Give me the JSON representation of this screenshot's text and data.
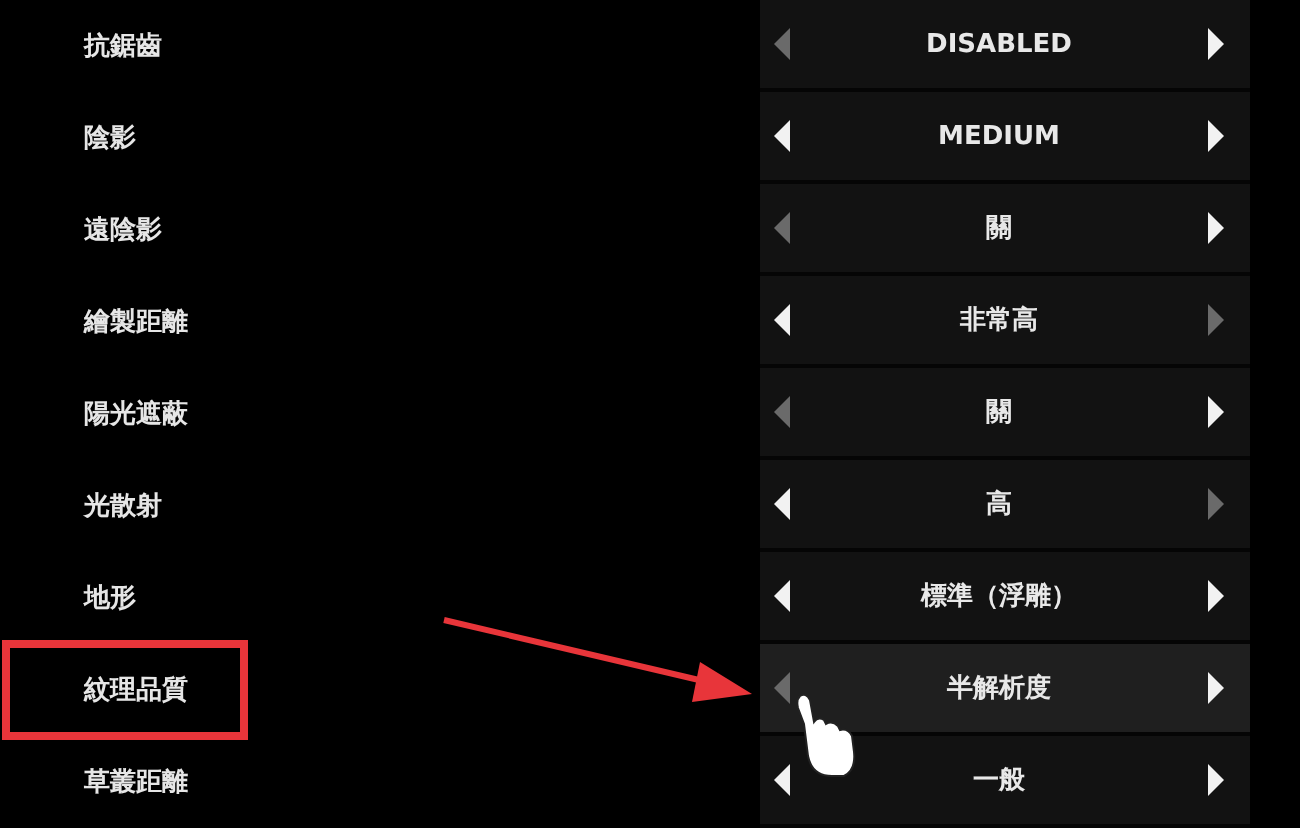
{
  "settings": [
    {
      "label": "抗鋸齒",
      "value": "DISABLED",
      "left_enabled": false,
      "right_enabled": true,
      "selected": false,
      "outlined": false
    },
    {
      "label": "陰影",
      "value": "MEDIUM",
      "left_enabled": true,
      "right_enabled": true,
      "selected": false,
      "outlined": false
    },
    {
      "label": "遠陰影",
      "value": "關",
      "left_enabled": false,
      "right_enabled": true,
      "selected": false,
      "outlined": false
    },
    {
      "label": "繪製距離",
      "value": "非常高",
      "left_enabled": true,
      "right_enabled": false,
      "selected": false,
      "outlined": false
    },
    {
      "label": "陽光遮蔽",
      "value": "關",
      "left_enabled": false,
      "right_enabled": true,
      "selected": false,
      "outlined": false
    },
    {
      "label": "光散射",
      "value": "高",
      "left_enabled": true,
      "right_enabled": false,
      "selected": false,
      "outlined": false
    },
    {
      "label": "地形",
      "value": "標準（浮雕）",
      "left_enabled": true,
      "right_enabled": true,
      "selected": false,
      "outlined": false
    },
    {
      "label": "紋理品質",
      "value": "半解析度",
      "left_enabled": false,
      "right_enabled": true,
      "selected": true,
      "outlined": true
    },
    {
      "label": "草叢距離",
      "value": "一般",
      "left_enabled": true,
      "right_enabled": true,
      "selected": false,
      "outlined": false
    }
  ]
}
